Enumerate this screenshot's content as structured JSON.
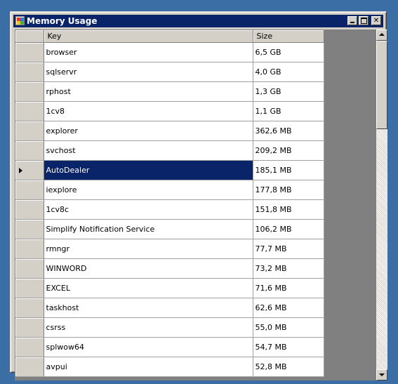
{
  "window": {
    "title": "Memory Usage"
  },
  "grid": {
    "columns": [
      "Key",
      "Size"
    ],
    "selected_row": 6,
    "rows": [
      {
        "key": "browser",
        "size": "6,5 GB"
      },
      {
        "key": "sqlservr",
        "size": "4,0 GB"
      },
      {
        "key": "rphost",
        "size": "1,3 GB"
      },
      {
        "key": "1cv8",
        "size": "1,1 GB"
      },
      {
        "key": "explorer",
        "size": "362,6 MB"
      },
      {
        "key": "svchost",
        "size": "209,2 MB"
      },
      {
        "key": "AutoDealer",
        "size": "185,1 MB"
      },
      {
        "key": "iexplore",
        "size": "177,8 MB"
      },
      {
        "key": "1cv8c",
        "size": "151,8 MB"
      },
      {
        "key": "Simplify Notification Service",
        "size": "106,2 MB"
      },
      {
        "key": "rmngr",
        "size": "77,7 MB"
      },
      {
        "key": "WINWORD",
        "size": "73,2 MB"
      },
      {
        "key": "EXCEL",
        "size": "71,6 MB"
      },
      {
        "key": "taskhost",
        "size": "62,6 MB"
      },
      {
        "key": "csrss",
        "size": "55,0 MB"
      },
      {
        "key": "splwow64",
        "size": "54,7 MB"
      },
      {
        "key": "avpui",
        "size": "52,8 MB"
      }
    ]
  },
  "icons": {
    "window_icon": "app-icon",
    "minimize": "minimize-icon",
    "maximize": "maximize-icon",
    "close": "close-icon",
    "row_indicator": "current-row-arrow-icon",
    "scroll_up": "scroll-up-icon",
    "scroll_down": "scroll-down-icon"
  },
  "colors": {
    "title_bar": "#0a246a",
    "selection": "#0a246a",
    "desktop": "#3a6ea5",
    "grid_background": "#808080"
  }
}
